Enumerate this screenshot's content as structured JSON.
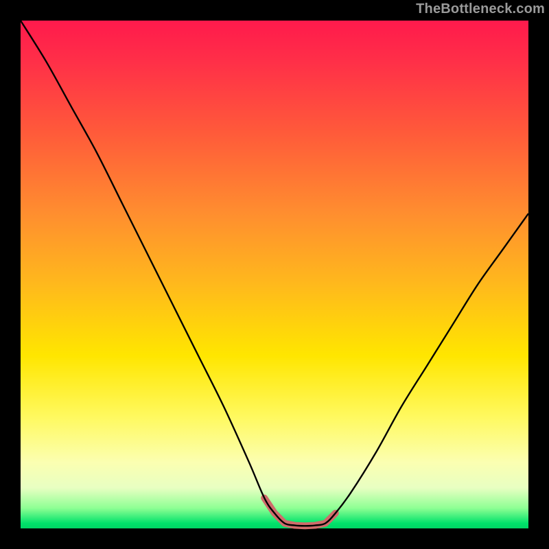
{
  "watermark": "TheBottleneck.com",
  "chart_data": {
    "type": "line",
    "title": "",
    "xlabel": "",
    "ylabel": "",
    "xlim": [
      0,
      100
    ],
    "ylim": [
      0,
      100
    ],
    "grid": false,
    "legend": false,
    "series": [
      {
        "name": "bottleneck-curve",
        "color": "#000000",
        "x": [
          0,
          5,
          10,
          15,
          20,
          25,
          30,
          35,
          40,
          45,
          48,
          50,
          52,
          54,
          56,
          58,
          60,
          62,
          65,
          70,
          75,
          80,
          85,
          90,
          95,
          100
        ],
        "values": [
          100,
          92,
          83,
          74,
          64,
          54,
          44,
          34,
          24,
          13,
          6,
          3,
          1,
          0.6,
          0.5,
          0.6,
          1,
          3,
          7,
          15,
          24,
          32,
          40,
          48,
          55,
          62
        ]
      }
    ],
    "annotations": [
      {
        "name": "trough-marker",
        "color": "#cf6b6b",
        "x_range": [
          48,
          64
        ],
        "y": 1.1
      }
    ],
    "gradient_stops": [
      {
        "pos": 0,
        "color": "#ff1a4c"
      },
      {
        "pos": 22,
        "color": "#ff5a3a"
      },
      {
        "pos": 52,
        "color": "#ffb91c"
      },
      {
        "pos": 78,
        "color": "#fff95f"
      },
      {
        "pos": 96,
        "color": "#8eff94"
      },
      {
        "pos": 100,
        "color": "#00d564"
      }
    ]
  }
}
